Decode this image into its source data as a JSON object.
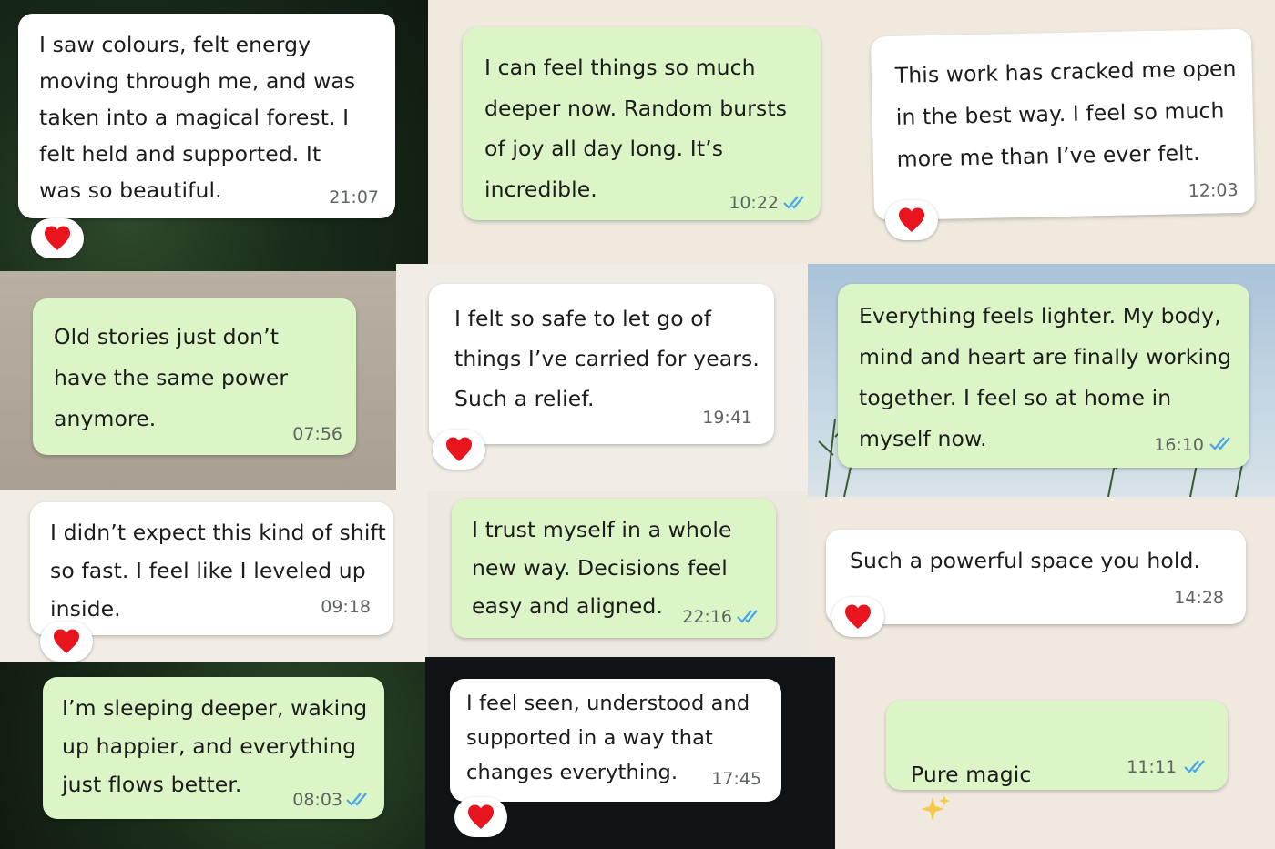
{
  "theme": {
    "incoming": "#ffffff",
    "outgoing": "#dcf5c6",
    "tick": "#4aa5e8",
    "heart": "#e8141e"
  },
  "messages": [
    {
      "text": "I saw colours, felt energy\nmoving through me, and was\ntaken into a magical forest. I\nfelt held and supported. It\nwas so beautiful.",
      "time": "21:07",
      "direction": "incoming",
      "reaction": "heart-icon"
    },
    {
      "text": "I can feel things so much\ndeeper now. Random bursts\nof joy all day long. It’s\nincredible.",
      "time": "10:22",
      "direction": "outgoing",
      "status": "read"
    },
    {
      "text": "This work has cracked me open\nin the best way. I feel so much\nmore me than I’ve ever felt.",
      "time": "12:03",
      "direction": "incoming",
      "reaction": "heart-icon"
    },
    {
      "text": "Old stories just don’t\nhave the same power\nanymore.",
      "time": "07:56",
      "direction": "outgoing"
    },
    {
      "text": "I felt so safe to let go of\nthings I’ve carried for years.\nSuch a relief.",
      "time": "19:41",
      "direction": "incoming",
      "reaction": "heart-icon"
    },
    {
      "text": "Everything feels lighter. My body,\nmind and heart are finally working\ntogether. I feel so at home in\nmyself now.",
      "time": "16:10",
      "direction": "outgoing",
      "status": "read"
    },
    {
      "text": "I didn’t expect this kind of shift\nso fast. I feel like I leveled up\ninside.",
      "time": "09:18",
      "direction": "incoming",
      "reaction": "heart-icon"
    },
    {
      "text": "I trust myself in a whole\nnew way. Decisions feel\neasy and aligned.",
      "time": "22:16",
      "direction": "outgoing",
      "status": "read"
    },
    {
      "text": "Such a powerful space you hold.",
      "time": "14:28",
      "direction": "incoming",
      "reaction": "heart-icon"
    },
    {
      "text": "I’m sleeping deeper, waking\nup happier, and everything\njust flows better.",
      "time": "08:03",
      "direction": "outgoing",
      "status": "read"
    },
    {
      "text": "I feel seen, understood and\nsupported in a way that\nchanges everything.",
      "time": "17:45",
      "direction": "incoming",
      "reaction": "heart-icon"
    },
    {
      "text": "Pure magic",
      "emoji": "sparkles-icon",
      "time": "11:11",
      "direction": "outgoing",
      "status": "read"
    }
  ]
}
